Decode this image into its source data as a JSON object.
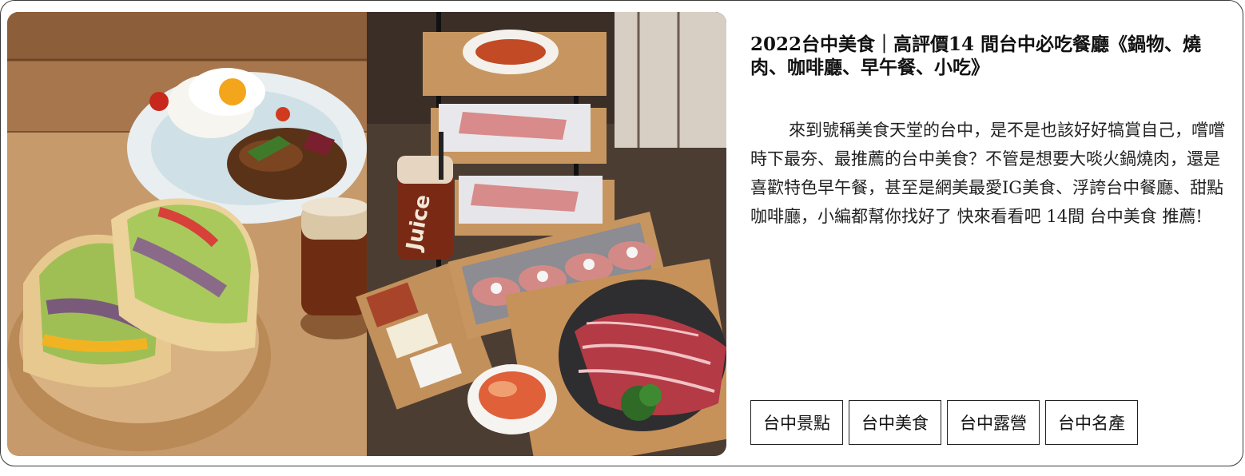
{
  "article": {
    "title": "2022台中美食｜高評價14 間台中必吃餐廳《鍋物、燒肉、咖啡廳、早午餐、小吃》",
    "description": "來到號稱美食天堂的台中，是不是也該好好犒賞自己，嚐嚐時下最夯、最推薦的台中美食？不管是想要大啖火鍋燒肉，還是喜歡特色早午餐，甚至是網美最愛IG美食、浮誇台中餐廳、甜點咖啡廳，小編都幫你找好了 快來看看吧 14間 台中美食 推薦!",
    "image_alt": "台中美食"
  },
  "photo": {
    "cup_label": "Juice",
    "left_panel_color": "#c9a27a",
    "right_panel_color": "#5b4a3e"
  },
  "tags": [
    {
      "label": "台中景點"
    },
    {
      "label": "台中美食"
    },
    {
      "label": "台中露營"
    },
    {
      "label": "台中名產"
    }
  ]
}
